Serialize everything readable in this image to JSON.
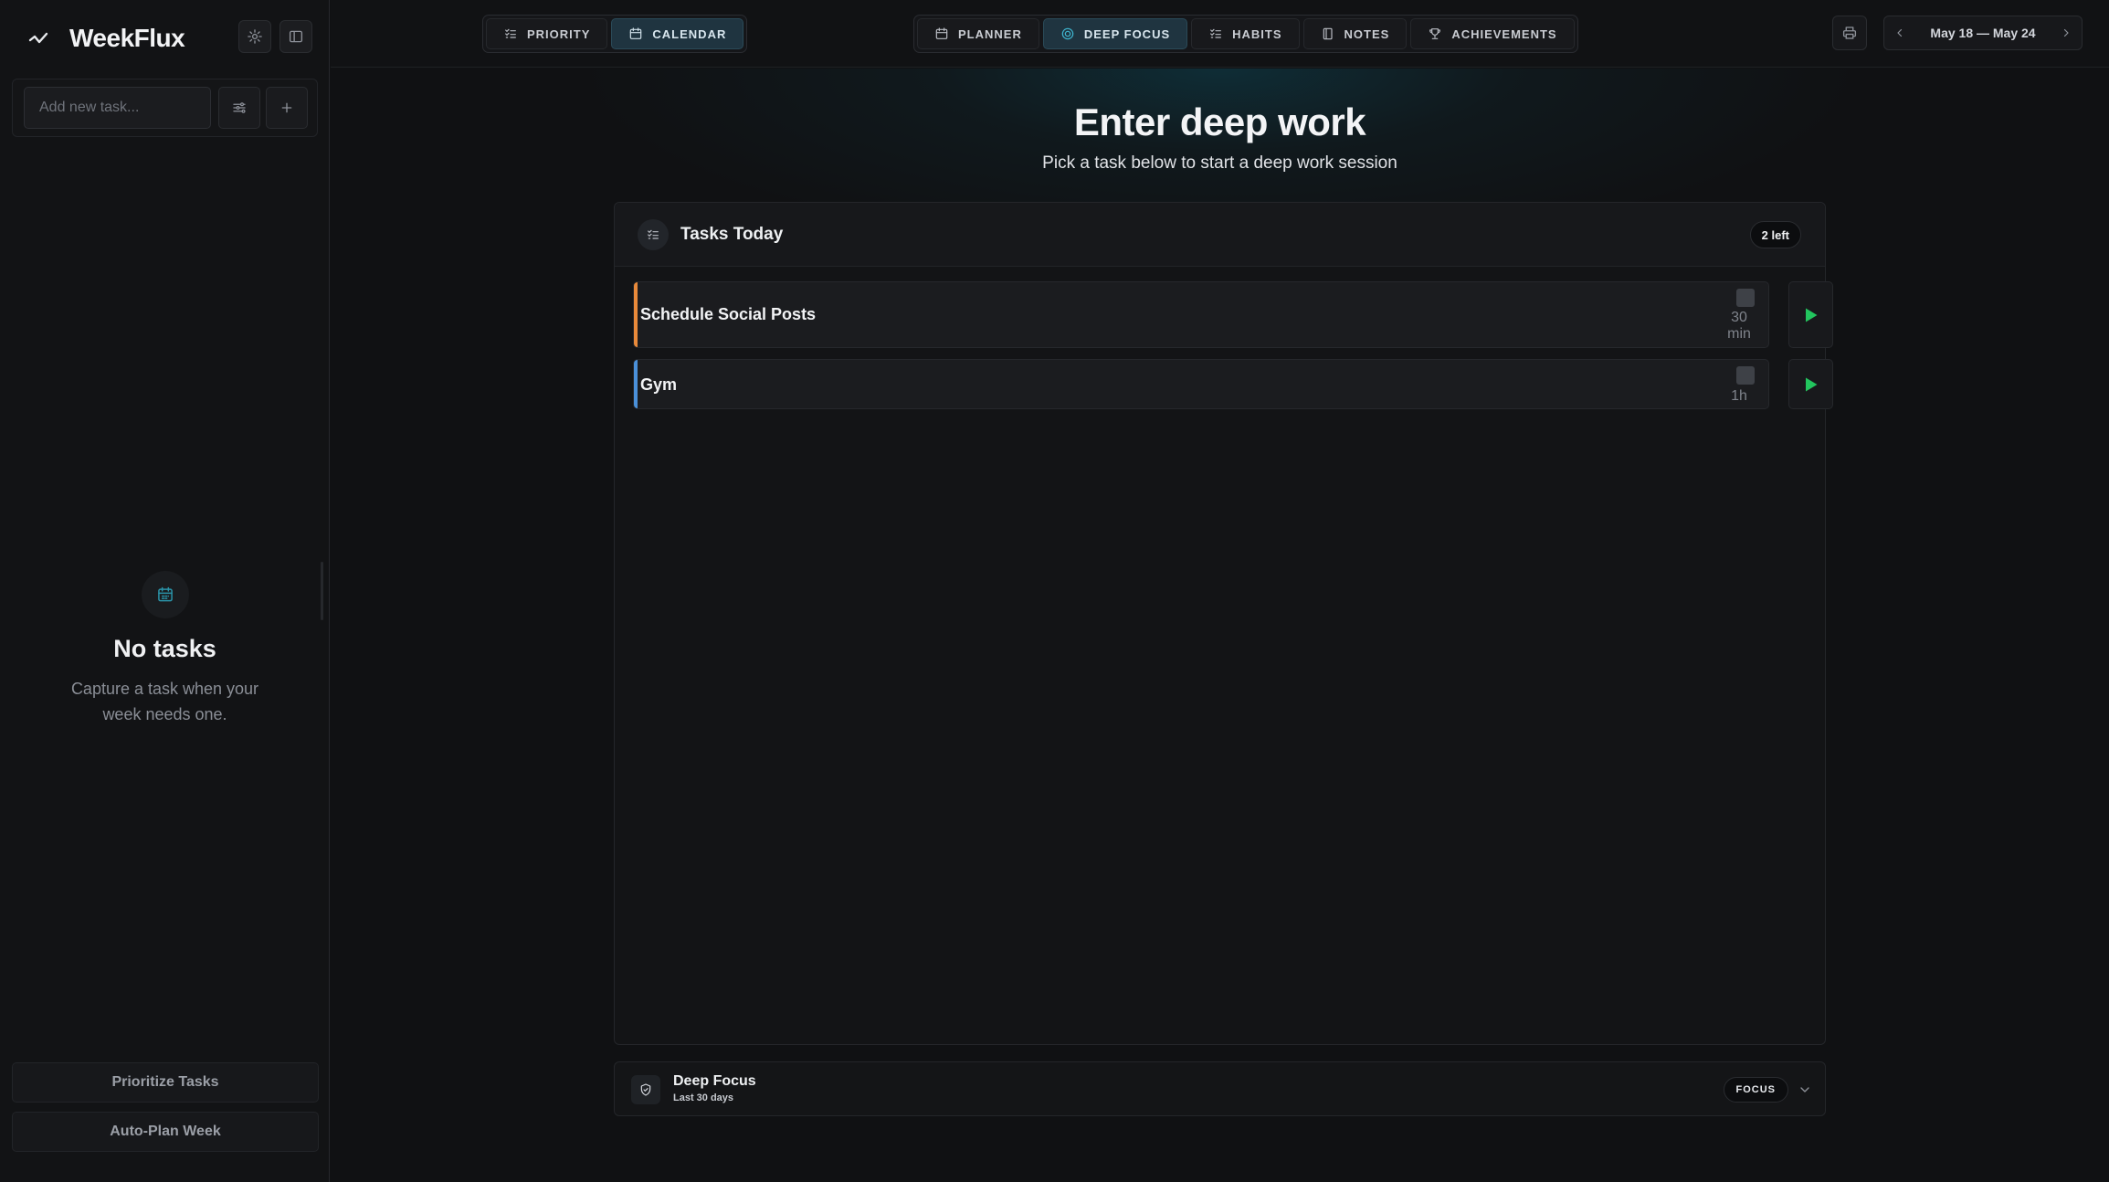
{
  "sidebar": {
    "brand": "WeekFlux",
    "add_placeholder": "Add new task...",
    "empty_title": "No tasks",
    "empty_subtitle": "Capture a task when your week needs one.",
    "actions": [
      "Prioritize Tasks",
      "Auto-Plan Week"
    ]
  },
  "topbar": {
    "view_toggle": [
      {
        "label": "PRIORITY",
        "icon": "list-sort-icon",
        "active": false
      },
      {
        "label": "CALENDAR",
        "icon": "calendar-icon",
        "active": true
      }
    ],
    "tabs": [
      {
        "label": "PLANNER",
        "icon": "calendar-icon",
        "active": false
      },
      {
        "label": "DEEP FOCUS",
        "icon": "target-icon",
        "active": true
      },
      {
        "label": "HABITS",
        "icon": "checklist-icon",
        "active": false
      },
      {
        "label": "NOTES",
        "icon": "notebook-icon",
        "active": false
      },
      {
        "label": "ACHIEVEMENTS",
        "icon": "trophy-icon",
        "active": false
      }
    ],
    "week_range": "May 18 — May 24"
  },
  "main": {
    "title": "Enter deep work",
    "subtitle": "Pick a task below to start a deep work session",
    "tasks_card": {
      "title": "Tasks Today",
      "remaining_badge": "2 left",
      "tasks": [
        {
          "name": "Schedule Social Posts",
          "duration_value": "30",
          "duration_unit": "min",
          "accent": "#e8893a"
        },
        {
          "name": "Gym",
          "duration_value": "1h",
          "duration_unit": "",
          "accent": "#4a90d9"
        }
      ]
    },
    "focus_panel": {
      "title": "Deep Focus",
      "subtitle": "Last 30 days",
      "badge": "FOCUS"
    }
  },
  "colors": {
    "accent_teal": "#1f3440",
    "play_green": "#22c55e",
    "background": "#101113"
  }
}
